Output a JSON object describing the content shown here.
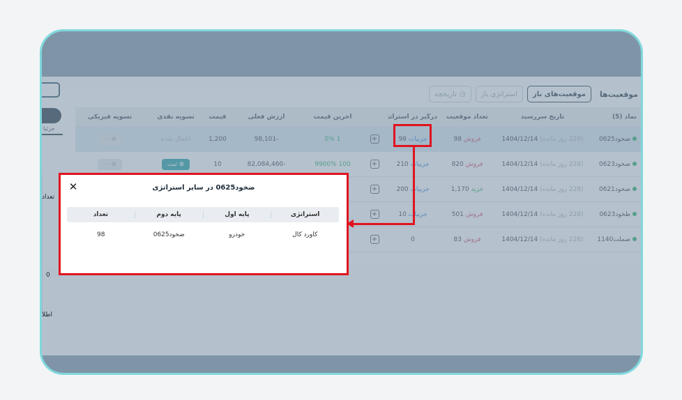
{
  "header": {
    "title": "موقعیت‌ها",
    "tabs": [
      {
        "label": "موقعیت‌های باز",
        "active": true
      },
      {
        "label": "استراتژی باز",
        "active": false
      },
      {
        "label": "تاریخچه",
        "active": false
      }
    ]
  },
  "table": {
    "columns": [
      "نماد (5)",
      "تاریخ سررسید",
      "تعداد موقعیت",
      "درگیر در استراتژی",
      "",
      "آخرین قیمت",
      "ارزش فعلی",
      "قیمت",
      "تسویه نقدی",
      "تسویه فیزیکی"
    ],
    "rows": [
      {
        "symbol": "ضخود0625",
        "date": "1404/12/14",
        "remain": "(228 روز مانده)",
        "qty": "98",
        "side": "فروش",
        "strat": "98",
        "strat_label": "جزییات",
        "last": "1 0%",
        "value": "-98,101",
        "price": "1,200",
        "cash": "اعمال شده"
      },
      {
        "symbol": "ضخود0623",
        "date": "1404/12/14",
        "remain": "(228 روز مانده)",
        "qty": "820",
        "side": "فروش",
        "strat": "210",
        "strat_label": "جزییات",
        "last": "100 9900%",
        "value": "-82,084,460",
        "price": "10",
        "cash": "ثبت"
      },
      {
        "symbol": "ضخود0621",
        "date": "1404/12/14",
        "remain": "(228 روز مانده)",
        "qty": "1,170",
        "side": "خرید",
        "strat": "200",
        "strat_label": "جزییات",
        "last": "",
        "value": "",
        "price": "",
        "cash": ""
      },
      {
        "symbol": "طخود0623",
        "date": "1404/12/14",
        "remain": "(228 روز مانده)",
        "qty": "501",
        "side": "فروش",
        "strat": "10",
        "strat_label": "جزییات",
        "last": "",
        "value": "",
        "price": "",
        "cash": ""
      },
      {
        "symbol": "ضملت1140",
        "date": "1404/12/14",
        "remain": "(228 روز مانده)",
        "qty": "83",
        "side": "فروش",
        "strat": "0",
        "strat_label": "",
        "last": "",
        "value": "",
        "price": "",
        "cash": ""
      }
    ]
  },
  "sidebar": {
    "text_top": "جزئیا",
    "label_count": "تعداد",
    "value_zero": "0",
    "label_info": "اطلا"
  },
  "modal": {
    "title": "ضخود0625 در سایر استراتژی",
    "columns": [
      "استراتژی",
      "پایه اول",
      "پایه دوم",
      "تعداد"
    ],
    "rows": [
      {
        "strategy": "کاورد کال",
        "leg1": "خودرو",
        "leg2": "ضخود0625",
        "count": "98"
      }
    ]
  },
  "colors": {
    "highlight": "#e0131f",
    "frame": "#7fd8dc",
    "overlay": "#7f95a7",
    "accent": "#1a9ea3"
  }
}
